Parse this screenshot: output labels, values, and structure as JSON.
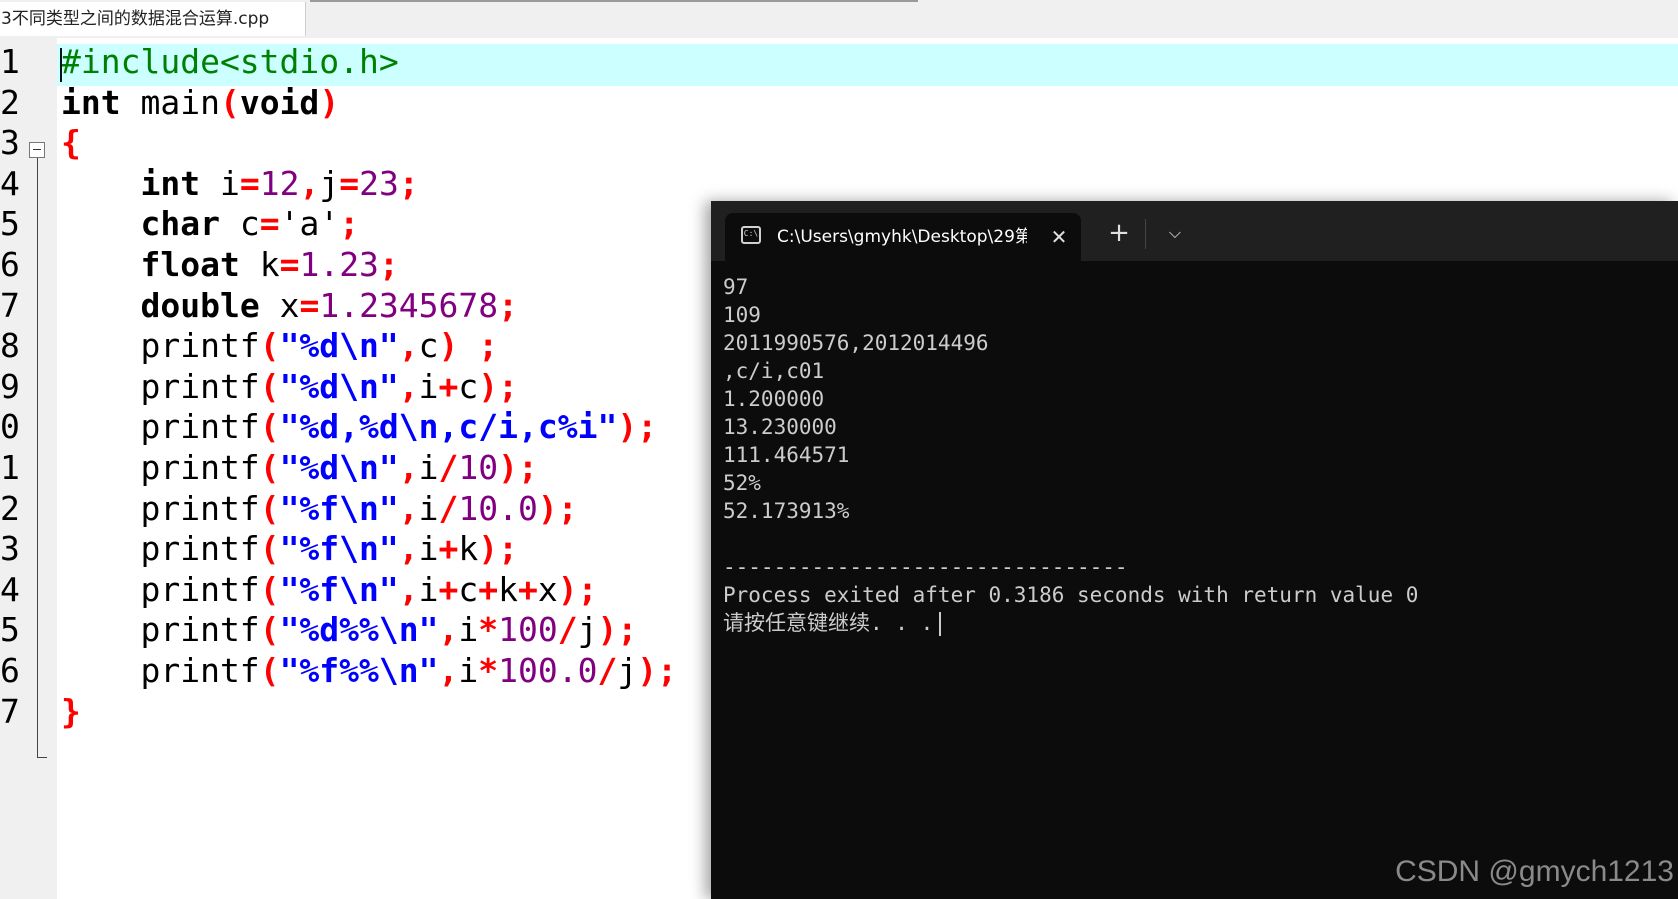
{
  "editor": {
    "file_tab": "3不同类型之间的数据混合运算.cpp",
    "line_numbers": [
      "1",
      "2",
      "3",
      "4",
      "5",
      "6",
      "7",
      "8",
      "9",
      "0",
      "1",
      "2",
      "3",
      "4",
      "5",
      "6",
      "7"
    ],
    "lines": [
      [
        {
          "t": "#include<stdio.h>",
          "c": "pp"
        }
      ],
      [
        {
          "t": "int",
          "c": "kw"
        },
        {
          "t": " main",
          "c": "plain"
        },
        {
          "t": "(",
          "c": "op"
        },
        {
          "t": "void",
          "c": "kw"
        },
        {
          "t": ")",
          "c": "op"
        }
      ],
      [
        {
          "t": "{",
          "c": "op"
        }
      ],
      [
        {
          "t": "    ",
          "c": "plain"
        },
        {
          "t": "int",
          "c": "kw"
        },
        {
          "t": " i",
          "c": "plain"
        },
        {
          "t": "=",
          "c": "op"
        },
        {
          "t": "12",
          "c": "num"
        },
        {
          "t": ",",
          "c": "op"
        },
        {
          "t": "j",
          "c": "plain"
        },
        {
          "t": "=",
          "c": "op"
        },
        {
          "t": "23",
          "c": "num"
        },
        {
          "t": ";",
          "c": "op"
        }
      ],
      [
        {
          "t": "    ",
          "c": "plain"
        },
        {
          "t": "char",
          "c": "kw"
        },
        {
          "t": " c",
          "c": "plain"
        },
        {
          "t": "=",
          "c": "op"
        },
        {
          "t": "'a'",
          "c": "plain"
        },
        {
          "t": ";",
          "c": "op"
        }
      ],
      [
        {
          "t": "    ",
          "c": "plain"
        },
        {
          "t": "float",
          "c": "kw"
        },
        {
          "t": " k",
          "c": "plain"
        },
        {
          "t": "=",
          "c": "op"
        },
        {
          "t": "1.23",
          "c": "num"
        },
        {
          "t": ";",
          "c": "op"
        }
      ],
      [
        {
          "t": "    ",
          "c": "plain"
        },
        {
          "t": "double",
          "c": "kw"
        },
        {
          "t": " x",
          "c": "plain"
        },
        {
          "t": "=",
          "c": "op"
        },
        {
          "t": "1.2345678",
          "c": "num"
        },
        {
          "t": ";",
          "c": "op"
        }
      ],
      [
        {
          "t": "    printf",
          "c": "plain"
        },
        {
          "t": "(",
          "c": "op"
        },
        {
          "t": "\"%d\\n\"",
          "c": "str"
        },
        {
          "t": ",",
          "c": "op"
        },
        {
          "t": "c",
          "c": "plain"
        },
        {
          "t": ") ;",
          "c": "op"
        }
      ],
      [
        {
          "t": "    printf",
          "c": "plain"
        },
        {
          "t": "(",
          "c": "op"
        },
        {
          "t": "\"%d\\n\"",
          "c": "str"
        },
        {
          "t": ",",
          "c": "op"
        },
        {
          "t": "i",
          "c": "plain"
        },
        {
          "t": "+",
          "c": "op"
        },
        {
          "t": "c",
          "c": "plain"
        },
        {
          "t": ");",
          "c": "op"
        }
      ],
      [
        {
          "t": "    printf",
          "c": "plain"
        },
        {
          "t": "(",
          "c": "op"
        },
        {
          "t": "\"%d,%d\\n,c/i,c%i\"",
          "c": "str"
        },
        {
          "t": ");",
          "c": "op"
        }
      ],
      [
        {
          "t": "    printf",
          "c": "plain"
        },
        {
          "t": "(",
          "c": "op"
        },
        {
          "t": "\"%d\\n\"",
          "c": "str"
        },
        {
          "t": ",",
          "c": "op"
        },
        {
          "t": "i",
          "c": "plain"
        },
        {
          "t": "/",
          "c": "op"
        },
        {
          "t": "10",
          "c": "num"
        },
        {
          "t": ");",
          "c": "op"
        }
      ],
      [
        {
          "t": "    printf",
          "c": "plain"
        },
        {
          "t": "(",
          "c": "op"
        },
        {
          "t": "\"%f\\n\"",
          "c": "str"
        },
        {
          "t": ",",
          "c": "op"
        },
        {
          "t": "i",
          "c": "plain"
        },
        {
          "t": "/",
          "c": "op"
        },
        {
          "t": "10.0",
          "c": "num"
        },
        {
          "t": ");",
          "c": "op"
        }
      ],
      [
        {
          "t": "    printf",
          "c": "plain"
        },
        {
          "t": "(",
          "c": "op"
        },
        {
          "t": "\"%f\\n\"",
          "c": "str"
        },
        {
          "t": ",",
          "c": "op"
        },
        {
          "t": "i",
          "c": "plain"
        },
        {
          "t": "+",
          "c": "op"
        },
        {
          "t": "k",
          "c": "plain"
        },
        {
          "t": ");",
          "c": "op"
        }
      ],
      [
        {
          "t": "    printf",
          "c": "plain"
        },
        {
          "t": "(",
          "c": "op"
        },
        {
          "t": "\"%f\\n\"",
          "c": "str"
        },
        {
          "t": ",",
          "c": "op"
        },
        {
          "t": "i",
          "c": "plain"
        },
        {
          "t": "+",
          "c": "op"
        },
        {
          "t": "c",
          "c": "plain"
        },
        {
          "t": "+",
          "c": "op"
        },
        {
          "t": "k",
          "c": "plain"
        },
        {
          "t": "+",
          "c": "op"
        },
        {
          "t": "x",
          "c": "plain"
        },
        {
          "t": ");",
          "c": "op"
        }
      ],
      [
        {
          "t": "    printf",
          "c": "plain"
        },
        {
          "t": "(",
          "c": "op"
        },
        {
          "t": "\"%d%%\\n\"",
          "c": "str"
        },
        {
          "t": ",",
          "c": "op"
        },
        {
          "t": "i",
          "c": "plain"
        },
        {
          "t": "*",
          "c": "op"
        },
        {
          "t": "100",
          "c": "num"
        },
        {
          "t": "/",
          "c": "op"
        },
        {
          "t": "j",
          "c": "plain"
        },
        {
          "t": ");",
          "c": "op"
        }
      ],
      [
        {
          "t": "    printf",
          "c": "plain"
        },
        {
          "t": "(",
          "c": "op"
        },
        {
          "t": "\"%f%%\\n\"",
          "c": "str"
        },
        {
          "t": ",",
          "c": "op"
        },
        {
          "t": "i",
          "c": "plain"
        },
        {
          "t": "*",
          "c": "op"
        },
        {
          "t": "100.0",
          "c": "num"
        },
        {
          "t": "/",
          "c": "op"
        },
        {
          "t": "j",
          "c": "plain"
        },
        {
          "t": ");",
          "c": "op"
        }
      ],
      [
        {
          "t": "}",
          "c": "op"
        }
      ]
    ]
  },
  "terminal": {
    "tab_title": "C:\\Users\\gmyhk\\Desktop\\29第",
    "tab_icon": "terminal-icon",
    "close_glyph": "✕",
    "new_tab_glyph": "+",
    "dropdown_glyph": "⌵",
    "output": [
      "97",
      "109",
      "2011990576,2012014496",
      ",c/i,c01",
      "1.200000",
      "13.230000",
      "111.464571",
      "52%",
      "52.173913%",
      "",
      "--------------------------------",
      "Process exited after 0.3186 seconds with return value 0",
      "请按任意键继续. . ."
    ]
  },
  "watermark": "CSDN @gmych1213",
  "colors": {
    "keyword": "#000000",
    "preprocessor": "#008000",
    "number": "#800080",
    "string": "#0000ff",
    "operator": "#ff0000",
    "current_line": "#ccffff",
    "terminal_bg": "#0c0c0c"
  }
}
